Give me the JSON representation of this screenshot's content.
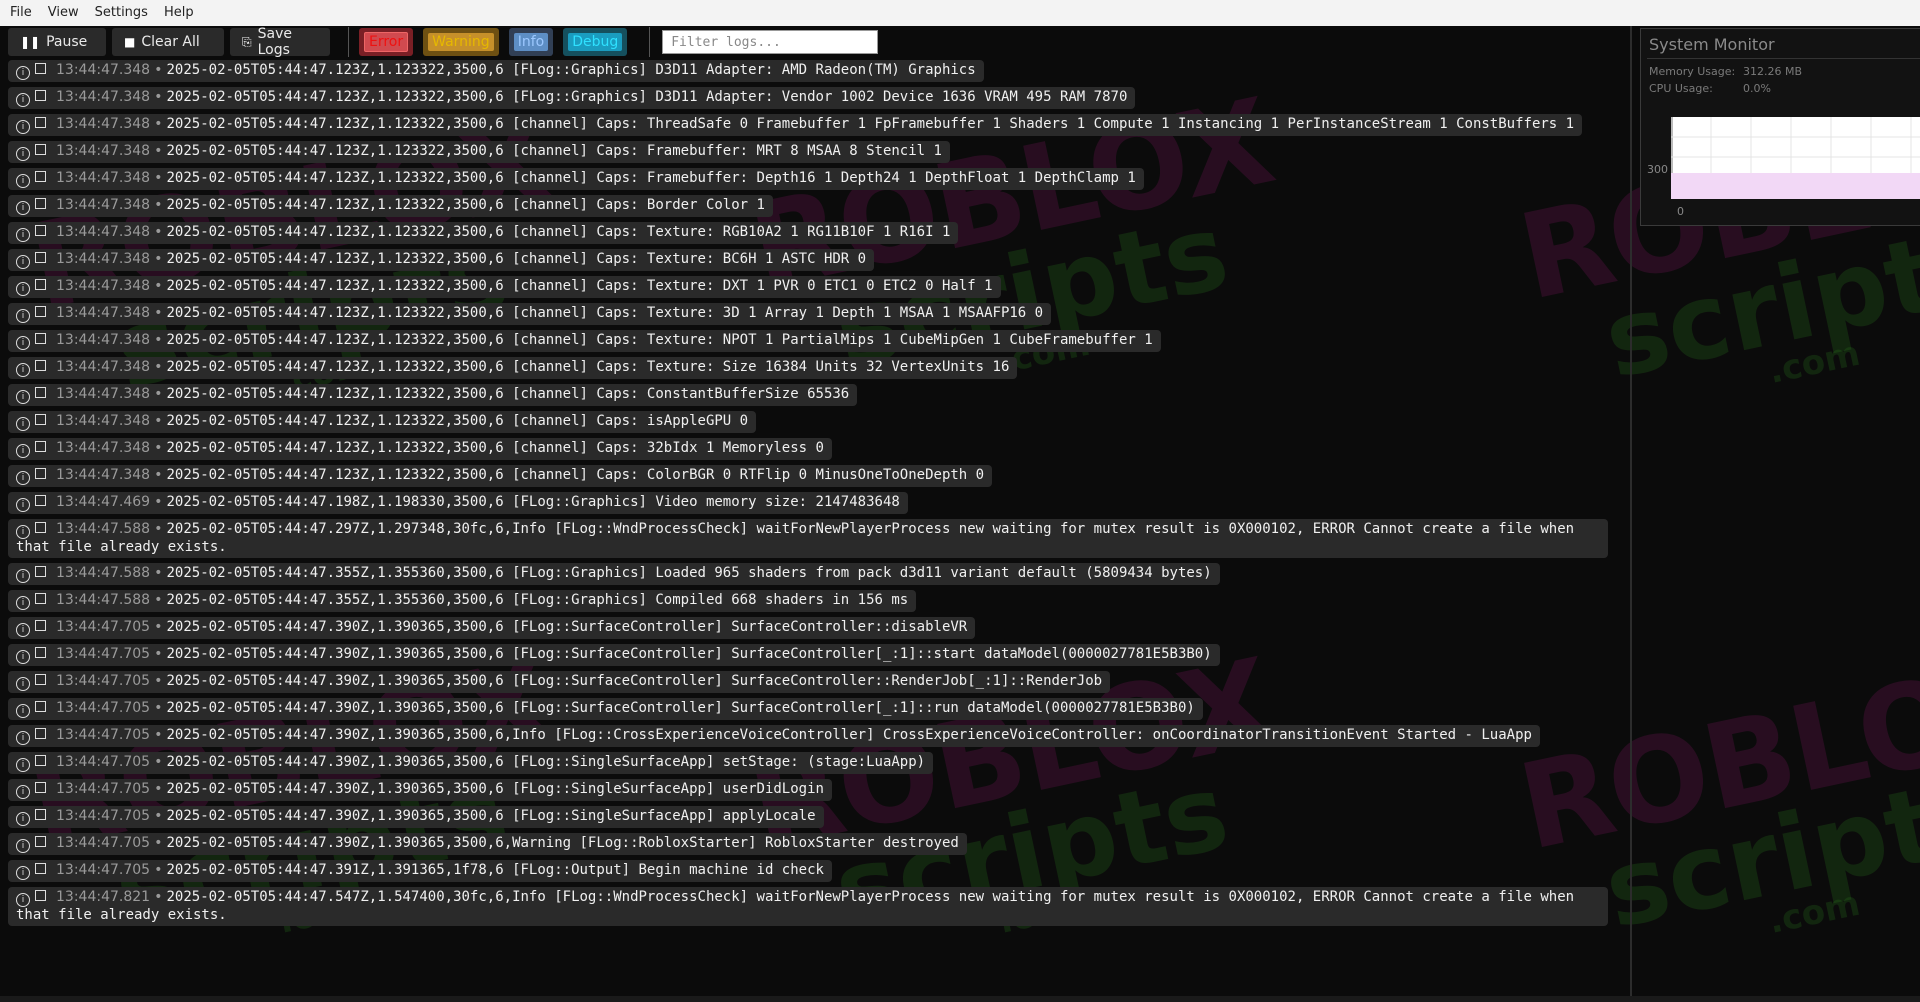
{
  "menu": {
    "items": [
      "File",
      "View",
      "Settings",
      "Help"
    ]
  },
  "toolbar": {
    "pause_label": "Pause",
    "clear_label": "Clear All",
    "save_label": "Save Logs",
    "levels": {
      "error": "Error",
      "warning": "Warning",
      "info": "Info",
      "debug": "Debug"
    },
    "filter_placeholder": "Filter logs..."
  },
  "logs": [
    {
      "time": "13:44:47.348",
      "text": "2025-02-05T05:44:47.123Z,1.123322,3500,6 [FLog::Graphics] D3D11 Adapter: AMD Radeon(TM) Graphics"
    },
    {
      "time": "13:44:47.348",
      "text": "2025-02-05T05:44:47.123Z,1.123322,3500,6 [FLog::Graphics] D3D11 Adapter: Vendor 1002 Device 1636 VRAM 495 RAM 7870"
    },
    {
      "time": "13:44:47.348",
      "text": "2025-02-05T05:44:47.123Z,1.123322,3500,6 [channel] Caps: ThreadSafe 0 Framebuffer 1 FpFramebuffer 1 Shaders 1 Compute 1 Instancing 1 PerInstanceStream 1 ConstBuffers 1"
    },
    {
      "time": "13:44:47.348",
      "text": "2025-02-05T05:44:47.123Z,1.123322,3500,6 [channel] Caps: Framebuffer: MRT 8 MSAA 8 Stencil 1"
    },
    {
      "time": "13:44:47.348",
      "text": "2025-02-05T05:44:47.123Z,1.123322,3500,6 [channel] Caps: Framebuffer: Depth16 1 Depth24 1 DepthFloat 1 DepthClamp 1"
    },
    {
      "time": "13:44:47.348",
      "text": "2025-02-05T05:44:47.123Z,1.123322,3500,6 [channel] Caps: Border Color 1"
    },
    {
      "time": "13:44:47.348",
      "text": "2025-02-05T05:44:47.123Z,1.123322,3500,6 [channel] Caps: Texture: RGB10A2 1 RG11B10F 1 R16I 1"
    },
    {
      "time": "13:44:47.348",
      "text": "2025-02-05T05:44:47.123Z,1.123322,3500,6 [channel] Caps: Texture: BC6H 1 ASTC HDR 0"
    },
    {
      "time": "13:44:47.348",
      "text": "2025-02-05T05:44:47.123Z,1.123322,3500,6 [channel] Caps: Texture: DXT 1 PVR 0 ETC1 0 ETC2 0 Half 1"
    },
    {
      "time": "13:44:47.348",
      "text": "2025-02-05T05:44:47.123Z,1.123322,3500,6 [channel] Caps: Texture: 3D 1 Array 1 Depth 1 MSAA 1 MSAAFP16 0"
    },
    {
      "time": "13:44:47.348",
      "text": "2025-02-05T05:44:47.123Z,1.123322,3500,6 [channel] Caps: Texture: NPOT 1 PartialMips 1 CubeMipGen 1 CubeFramebuffer 1"
    },
    {
      "time": "13:44:47.348",
      "text": "2025-02-05T05:44:47.123Z,1.123322,3500,6 [channel] Caps: Texture: Size 16384 Units 32 VertexUnits 16"
    },
    {
      "time": "13:44:47.348",
      "text": "2025-02-05T05:44:47.123Z,1.123322,3500,6 [channel] Caps: ConstantBufferSize 65536"
    },
    {
      "time": "13:44:47.348",
      "text": "2025-02-05T05:44:47.123Z,1.123322,3500,6 [channel] Caps: isAppleGPU 0"
    },
    {
      "time": "13:44:47.348",
      "text": "2025-02-05T05:44:47.123Z,1.123322,3500,6 [channel] Caps: 32bIdx 1 Memoryless 0"
    },
    {
      "time": "13:44:47.348",
      "text": "2025-02-05T05:44:47.123Z,1.123322,3500,6 [channel] Caps: ColorBGR 0 RTFlip 0 MinusOneToOneDepth 0"
    },
    {
      "time": "13:44:47.469",
      "text": "2025-02-05T05:44:47.198Z,1.198330,3500,6 [FLog::Graphics] Video memory size: 2147483648"
    },
    {
      "time": "13:44:47.588",
      "text": "2025-02-05T05:44:47.297Z,1.297348,30fc,6,Info [FLog::WndProcessCheck] waitForNewPlayerProcess new waiting for mutex result is 0X000102, ERROR Cannot create a file when that file already exists."
    },
    {
      "time": "13:44:47.588",
      "text": "2025-02-05T05:44:47.355Z,1.355360,3500,6 [FLog::Graphics] Loaded 965 shaders from pack d3d11 variant default (5809434 bytes)"
    },
    {
      "time": "13:44:47.588",
      "text": "2025-02-05T05:44:47.355Z,1.355360,3500,6 [FLog::Graphics] Compiled 668 shaders in 156 ms"
    },
    {
      "time": "13:44:47.705",
      "text": "2025-02-05T05:44:47.390Z,1.390365,3500,6 [FLog::SurfaceController] SurfaceController::disableVR"
    },
    {
      "time": "13:44:47.705",
      "text": "2025-02-05T05:44:47.390Z,1.390365,3500,6 [FLog::SurfaceController] SurfaceController[_:1]::start dataModel(0000027781E5B3B0)"
    },
    {
      "time": "13:44:47.705",
      "text": "2025-02-05T05:44:47.390Z,1.390365,3500,6 [FLog::SurfaceController] SurfaceController::RenderJob[_:1]::RenderJob"
    },
    {
      "time": "13:44:47.705",
      "text": "2025-02-05T05:44:47.390Z,1.390365,3500,6 [FLog::SurfaceController] SurfaceController[_:1]::run dataModel(0000027781E5B3B0)"
    },
    {
      "time": "13:44:47.705",
      "text": "2025-02-05T05:44:47.390Z,1.390365,3500,6,Info [FLog::CrossExperienceVoiceController] CrossExperienceVoiceController: onCoordinatorTransitionEvent Started - LuaApp"
    },
    {
      "time": "13:44:47.705",
      "text": "2025-02-05T05:44:47.390Z,1.390365,3500,6 [FLog::SingleSurfaceApp] setStage: (stage:LuaApp)"
    },
    {
      "time": "13:44:47.705",
      "text": "2025-02-05T05:44:47.390Z,1.390365,3500,6 [FLog::SingleSurfaceApp] userDidLogin"
    },
    {
      "time": "13:44:47.705",
      "text": "2025-02-05T05:44:47.390Z,1.390365,3500,6 [FLog::SingleSurfaceApp] applyLocale"
    },
    {
      "time": "13:44:47.705",
      "text": "2025-02-05T05:44:47.390Z,1.390365,3500,6,Warning [FLog::RobloxStarter] RobloxStarter destroyed"
    },
    {
      "time": "13:44:47.705",
      "text": "2025-02-05T05:44:47.391Z,1.391365,1f78,6 [FLog::Output] Begin machine id check"
    },
    {
      "time": "13:44:47.821",
      "text": "2025-02-05T05:44:47.547Z,1.547400,30fc,6,Info [FLog::WndProcessCheck] waitForNewPlayerProcess new waiting for mutex result is 0X000102, ERROR Cannot create a file when that file already exists."
    }
  ],
  "monitor": {
    "title": "System Monitor",
    "memory_label": "Memory Usage:",
    "memory_value": "312.26 MB",
    "cpu_label": "CPU Usage:",
    "cpu_value": "0.0%",
    "axis_300": "300",
    "axis_0": "0"
  },
  "watermark": {
    "line1": "ROBLOX",
    "line2": "scripts",
    "line3": ".com"
  },
  "colors": {
    "error": "#d14a4f",
    "warning": "#c6902a",
    "info": "#5d8ec5",
    "debug": "#1a9cbf"
  }
}
